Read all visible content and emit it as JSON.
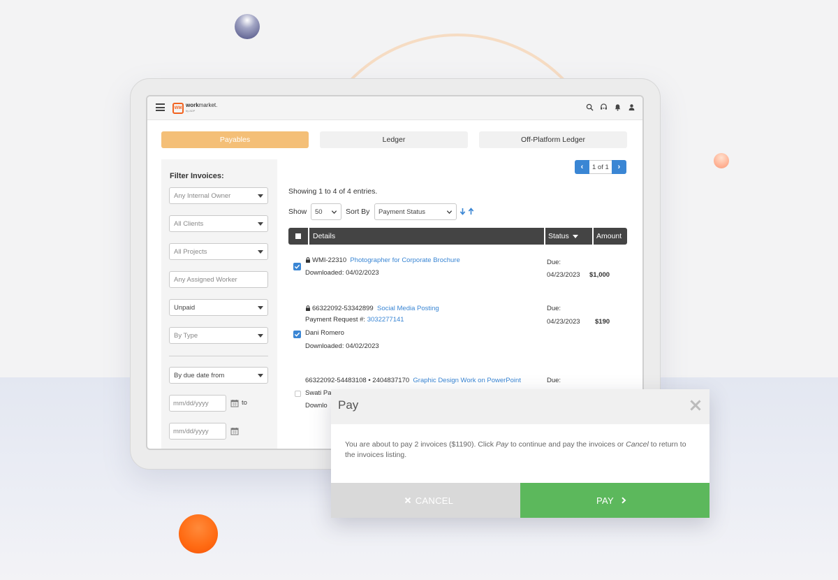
{
  "app": {
    "brand_mark": "WM",
    "brand_name_strong": "work",
    "brand_name_rest": "market.",
    "brand_sub": "by ADP"
  },
  "tabs": [
    {
      "label": "Payables",
      "active": true
    },
    {
      "label": "Ledger",
      "active": false
    },
    {
      "label": "Off-Platform Ledger",
      "active": false
    }
  ],
  "filters": {
    "title": "Filter Invoices:",
    "internal_owner": "Any Internal Owner",
    "clients": "All Clients",
    "projects": "All Projects",
    "assigned_worker_placeholder": "Any Assigned Worker",
    "status": "Unpaid",
    "type": "By Type",
    "due_date": "By due date from",
    "date_from_placeholder": "mm/dd/yyyy",
    "date_to_label": "to",
    "date_to_placeholder": "mm/dd/yyyy"
  },
  "pagination": {
    "text": "1 of 1",
    "prev": "‹",
    "next": "›"
  },
  "listing": {
    "showing": "Showing 1 to 4 of 4 entries.",
    "show_label": "Show",
    "show_value": "50",
    "sort_label": "Sort By",
    "sort_value": "Payment Status"
  },
  "table": {
    "headers": {
      "details": "Details",
      "status": "Status",
      "amount": "Amount"
    },
    "rows": [
      {
        "checked": true,
        "id": "WMI-22310",
        "title": "Photographer for Corporate Brochure",
        "downloaded": "Downloaded: 04/02/2023",
        "due_label": "Due:",
        "due_date": "04/23/2023",
        "amount": "$1,000"
      },
      {
        "checked": true,
        "id": "66322092-53342899",
        "title": "Social Media Posting",
        "payment_request_label": "Payment Request #:",
        "payment_request": "3032277141",
        "worker": "Dani Romero",
        "downloaded": "Downloaded: 04/02/2023",
        "due_label": "Due:",
        "due_date": "04/23/2023",
        "amount": "$190"
      },
      {
        "checked": false,
        "id": "66322092-54483108 • 2404837170",
        "title": "Graphic Design Work on PowerPoint",
        "worker_partial": "Swati Pa",
        "downloaded_partial": "Downlo",
        "due_label": "Due:"
      }
    ]
  },
  "modal": {
    "title": "Pay",
    "body_1": "You are about to pay 2 invoices ($1190). Click ",
    "body_pay": "Pay",
    "body_2": " to continue and pay the invoices or ",
    "body_cancel": "Cancel",
    "body_3": " to return to the invoices listing.",
    "cancel_label": "CANCEL",
    "pay_label": "PAY"
  },
  "colors": {
    "accent_tab": "#f4bf77",
    "link_blue": "#3a86d4",
    "pay_green": "#5cb85c",
    "brand_orange": "#f2621f"
  }
}
